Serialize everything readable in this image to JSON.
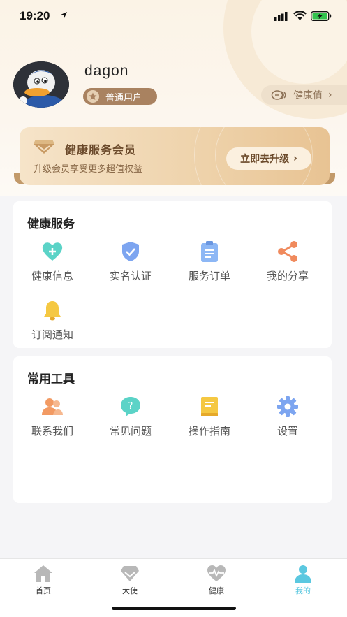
{
  "status_bar": {
    "time": "19:20"
  },
  "profile": {
    "username": "dagon",
    "badge": "普通用户",
    "health_value_label": "健康值"
  },
  "member_card": {
    "title": "健康服务会员",
    "subtitle": "升级会员享受更多超值权益",
    "upgrade_label": "立即去升级"
  },
  "health_services": {
    "title": "健康服务",
    "items": [
      {
        "label": "健康信息",
        "icon": "heart-plus-icon",
        "color": "#5bd3c7"
      },
      {
        "label": "实名认证",
        "icon": "shield-check-icon",
        "color": "#7da5f0"
      },
      {
        "label": "服务订单",
        "icon": "clipboard-icon",
        "color": "#8db7f5"
      },
      {
        "label": "我的分享",
        "icon": "share-icon",
        "color": "#f08a5d"
      },
      {
        "label": "订阅通知",
        "icon": "bell-icon",
        "color": "#f5c842"
      }
    ]
  },
  "common_tools": {
    "title": "常用工具",
    "items": [
      {
        "label": "联系我们",
        "icon": "contacts-icon",
        "color": "#f29a63"
      },
      {
        "label": "常见问题",
        "icon": "question-bubble-icon",
        "color": "#5bd3c7"
      },
      {
        "label": "操作指南",
        "icon": "guide-book-icon",
        "color": "#f5c842"
      },
      {
        "label": "设置",
        "icon": "gear-icon",
        "color": "#7da5f0"
      }
    ]
  },
  "tab_bar": {
    "active_color": "#5bc8e0",
    "items": [
      {
        "label": "首页",
        "icon": "home-icon",
        "active": false
      },
      {
        "label": "大使",
        "icon": "diamond-icon",
        "active": false
      },
      {
        "label": "健康",
        "icon": "heartbeat-icon",
        "active": false
      },
      {
        "label": "我的",
        "icon": "person-icon",
        "active": true
      }
    ]
  }
}
